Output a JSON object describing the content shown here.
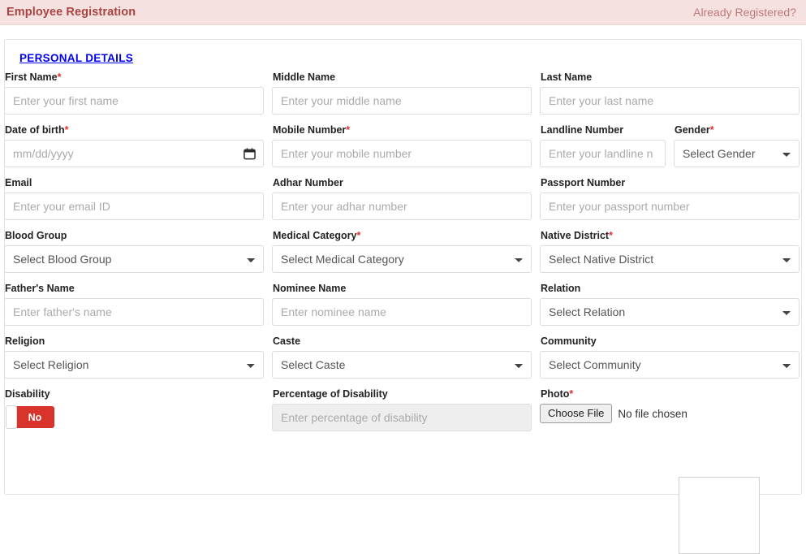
{
  "header": {
    "title": "Employee Registration",
    "already_registered_label": "Already Registered?"
  },
  "form": {
    "section_heading": "PERSONAL DETAILS",
    "rows": [
      {
        "fields": [
          {
            "label": "First Name",
            "required": true,
            "type": "text",
            "placeholder": "Enter your first name",
            "value": ""
          },
          {
            "label": "Middle Name",
            "required": false,
            "type": "text",
            "placeholder": "Enter your middle name",
            "value": ""
          },
          {
            "label": "Last Name",
            "required": false,
            "type": "text",
            "placeholder": "Enter your last name",
            "value": ""
          }
        ]
      },
      {
        "fields": [
          {
            "label": "Date of birth",
            "required": true,
            "type": "date",
            "placeholder": "mm/dd/yyyy",
            "value": ""
          },
          {
            "label": "Mobile Number",
            "required": true,
            "type": "text",
            "placeholder": "Enter your mobile number",
            "value": ""
          },
          {
            "label": "Landline Number",
            "required": false,
            "type": "text",
            "placeholder": "Enter your landline n",
            "value": ""
          },
          {
            "label": "Gender",
            "required": true,
            "type": "select",
            "placeholder": "Select Gender",
            "value": "Select Gender"
          }
        ]
      },
      {
        "fields": [
          {
            "label": "Email",
            "required": false,
            "type": "text",
            "placeholder": "Enter your email ID",
            "value": ""
          },
          {
            "label": "Adhar Number",
            "required": false,
            "type": "text",
            "placeholder": "Enter your adhar number",
            "value": ""
          },
          {
            "label": "Passport Number",
            "required": false,
            "type": "text",
            "placeholder": "Enter your passport number",
            "value": ""
          }
        ]
      },
      {
        "fields": [
          {
            "label": "Blood Group",
            "required": false,
            "type": "select",
            "placeholder": "Select Blood Group",
            "value": "Select Blood Group"
          },
          {
            "label": "Medical Category",
            "required": true,
            "type": "select",
            "placeholder": "Select Medical Category",
            "value": "Select Medical Category"
          },
          {
            "label": "Native District",
            "required": true,
            "type": "select",
            "placeholder": "Select Native District",
            "value": "Select Native District"
          }
        ]
      },
      {
        "fields": [
          {
            "label": "Father's Name",
            "required": false,
            "type": "text",
            "placeholder": "Enter father's name",
            "value": ""
          },
          {
            "label": "Nominee Name",
            "required": false,
            "type": "text",
            "placeholder": "Enter nominee name",
            "value": ""
          },
          {
            "label": "Relation",
            "required": false,
            "type": "select",
            "placeholder": "Select Relation",
            "value": "Select Relation"
          }
        ]
      },
      {
        "fields": [
          {
            "label": "Religion",
            "required": false,
            "type": "select",
            "placeholder": "Select Religion",
            "value": "Select Religion"
          },
          {
            "label": "Caste",
            "required": false,
            "type": "select",
            "placeholder": "Select Caste",
            "value": "Select Caste"
          },
          {
            "label": "Community",
            "required": false,
            "type": "select",
            "placeholder": "Select Community",
            "value": "Select Community"
          }
        ]
      }
    ],
    "disability": {
      "label": "Disability",
      "toggle_state_label": "No",
      "toggle_color": "#d9342b"
    },
    "percentage_of_disability": {
      "label": "Percentage of Disability",
      "placeholder": "Enter percentage of disability",
      "value": "",
      "disabled": true
    },
    "photo": {
      "label": "Photo",
      "required": true,
      "choose_file_label": "Choose File",
      "file_status": "No file chosen"
    }
  },
  "colors": {
    "header_bg": "#f5e1e0",
    "header_text": "#a94442",
    "section_link": "#0000ee",
    "required_asterisk": "#e03030",
    "toggle_off": "#d9342b"
  }
}
